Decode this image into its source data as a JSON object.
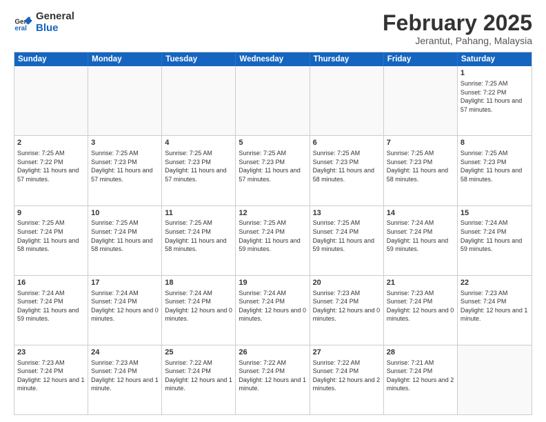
{
  "logo": {
    "general": "General",
    "blue": "Blue"
  },
  "header": {
    "month_year": "February 2025",
    "location": "Jerantut, Pahang, Malaysia"
  },
  "days_of_week": [
    "Sunday",
    "Monday",
    "Tuesday",
    "Wednesday",
    "Thursday",
    "Friday",
    "Saturday"
  ],
  "weeks": [
    {
      "cells": [
        {
          "day": "",
          "info": "",
          "empty": true
        },
        {
          "day": "",
          "info": "",
          "empty": true
        },
        {
          "day": "",
          "info": "",
          "empty": true
        },
        {
          "day": "",
          "info": "",
          "empty": true
        },
        {
          "day": "",
          "info": "",
          "empty": true
        },
        {
          "day": "",
          "info": "",
          "empty": true
        },
        {
          "day": "1",
          "info": "Sunrise: 7:25 AM\nSunset: 7:22 PM\nDaylight: 11 hours and 57 minutes.",
          "empty": false
        }
      ]
    },
    {
      "cells": [
        {
          "day": "2",
          "info": "Sunrise: 7:25 AM\nSunset: 7:22 PM\nDaylight: 11 hours and 57 minutes.",
          "empty": false
        },
        {
          "day": "3",
          "info": "Sunrise: 7:25 AM\nSunset: 7:23 PM\nDaylight: 11 hours and 57 minutes.",
          "empty": false
        },
        {
          "day": "4",
          "info": "Sunrise: 7:25 AM\nSunset: 7:23 PM\nDaylight: 11 hours and 57 minutes.",
          "empty": false
        },
        {
          "day": "5",
          "info": "Sunrise: 7:25 AM\nSunset: 7:23 PM\nDaylight: 11 hours and 57 minutes.",
          "empty": false
        },
        {
          "day": "6",
          "info": "Sunrise: 7:25 AM\nSunset: 7:23 PM\nDaylight: 11 hours and 58 minutes.",
          "empty": false
        },
        {
          "day": "7",
          "info": "Sunrise: 7:25 AM\nSunset: 7:23 PM\nDaylight: 11 hours and 58 minutes.",
          "empty": false
        },
        {
          "day": "8",
          "info": "Sunrise: 7:25 AM\nSunset: 7:23 PM\nDaylight: 11 hours and 58 minutes.",
          "empty": false
        }
      ]
    },
    {
      "cells": [
        {
          "day": "9",
          "info": "Sunrise: 7:25 AM\nSunset: 7:24 PM\nDaylight: 11 hours and 58 minutes.",
          "empty": false
        },
        {
          "day": "10",
          "info": "Sunrise: 7:25 AM\nSunset: 7:24 PM\nDaylight: 11 hours and 58 minutes.",
          "empty": false
        },
        {
          "day": "11",
          "info": "Sunrise: 7:25 AM\nSunset: 7:24 PM\nDaylight: 11 hours and 58 minutes.",
          "empty": false
        },
        {
          "day": "12",
          "info": "Sunrise: 7:25 AM\nSunset: 7:24 PM\nDaylight: 11 hours and 59 minutes.",
          "empty": false
        },
        {
          "day": "13",
          "info": "Sunrise: 7:25 AM\nSunset: 7:24 PM\nDaylight: 11 hours and 59 minutes.",
          "empty": false
        },
        {
          "day": "14",
          "info": "Sunrise: 7:24 AM\nSunset: 7:24 PM\nDaylight: 11 hours and 59 minutes.",
          "empty": false
        },
        {
          "day": "15",
          "info": "Sunrise: 7:24 AM\nSunset: 7:24 PM\nDaylight: 11 hours and 59 minutes.",
          "empty": false
        }
      ]
    },
    {
      "cells": [
        {
          "day": "16",
          "info": "Sunrise: 7:24 AM\nSunset: 7:24 PM\nDaylight: 11 hours and 59 minutes.",
          "empty": false
        },
        {
          "day": "17",
          "info": "Sunrise: 7:24 AM\nSunset: 7:24 PM\nDaylight: 12 hours and 0 minutes.",
          "empty": false
        },
        {
          "day": "18",
          "info": "Sunrise: 7:24 AM\nSunset: 7:24 PM\nDaylight: 12 hours and 0 minutes.",
          "empty": false
        },
        {
          "day": "19",
          "info": "Sunrise: 7:24 AM\nSunset: 7:24 PM\nDaylight: 12 hours and 0 minutes.",
          "empty": false
        },
        {
          "day": "20",
          "info": "Sunrise: 7:23 AM\nSunset: 7:24 PM\nDaylight: 12 hours and 0 minutes.",
          "empty": false
        },
        {
          "day": "21",
          "info": "Sunrise: 7:23 AM\nSunset: 7:24 PM\nDaylight: 12 hours and 0 minutes.",
          "empty": false
        },
        {
          "day": "22",
          "info": "Sunrise: 7:23 AM\nSunset: 7:24 PM\nDaylight: 12 hours and 1 minute.",
          "empty": false
        }
      ]
    },
    {
      "cells": [
        {
          "day": "23",
          "info": "Sunrise: 7:23 AM\nSunset: 7:24 PM\nDaylight: 12 hours and 1 minute.",
          "empty": false
        },
        {
          "day": "24",
          "info": "Sunrise: 7:23 AM\nSunset: 7:24 PM\nDaylight: 12 hours and 1 minute.",
          "empty": false
        },
        {
          "day": "25",
          "info": "Sunrise: 7:22 AM\nSunset: 7:24 PM\nDaylight: 12 hours and 1 minute.",
          "empty": false
        },
        {
          "day": "26",
          "info": "Sunrise: 7:22 AM\nSunset: 7:24 PM\nDaylight: 12 hours and 1 minute.",
          "empty": false
        },
        {
          "day": "27",
          "info": "Sunrise: 7:22 AM\nSunset: 7:24 PM\nDaylight: 12 hours and 2 minutes.",
          "empty": false
        },
        {
          "day": "28",
          "info": "Sunrise: 7:21 AM\nSunset: 7:24 PM\nDaylight: 12 hours and 2 minutes.",
          "empty": false
        },
        {
          "day": "",
          "info": "",
          "empty": true
        }
      ]
    }
  ]
}
